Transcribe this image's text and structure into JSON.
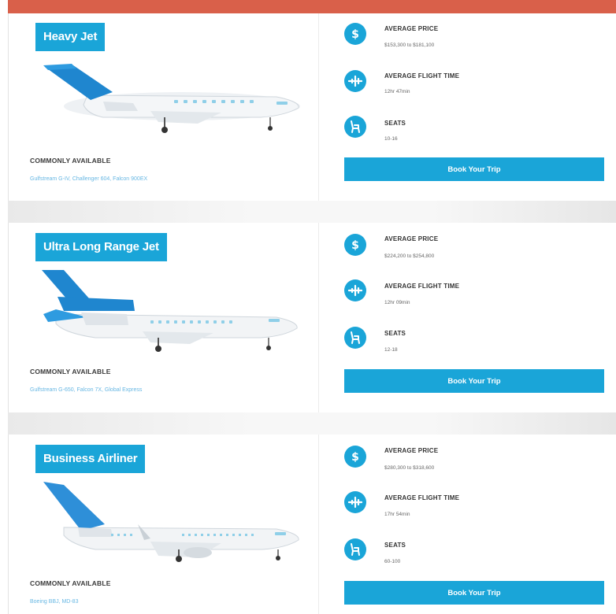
{
  "colors": {
    "accent": "#1aa5d8",
    "top_bar": "#d9604a",
    "link": "#67b7e3"
  },
  "labels": {
    "commonly_available": "COMMONLY AVAILABLE",
    "average_price": "AVERAGE PRICE",
    "average_flight_time": "AVERAGE FLIGHT TIME",
    "seats": "SEATS"
  },
  "cards": [
    {
      "title": "Heavy Jet",
      "models": "Gulfstream G-IV, Challenger 604, Falcon 900EX",
      "price": "$153,300 to $181,100",
      "flight_time": "12hr 47min",
      "seats": "10-16",
      "button": "Book Your Trip"
    },
    {
      "title": "Ultra Long Range Jet",
      "models": "Gulfstream G-650, Falcon 7X, Global Express",
      "price": "$224,200 to $254,800",
      "flight_time": "12hr 09min",
      "seats": "12-18",
      "button": "Book Your Trip"
    },
    {
      "title": "Business Airliner",
      "models": "Boeing BBJ, MD-83",
      "price": "$280,300 to $318,600",
      "flight_time": "17hr 54min",
      "seats": "60-100",
      "button": "Book Your Trip"
    }
  ],
  "icons": {
    "price": "dollar-icon",
    "flight_time": "airplane-icon",
    "seats": "seat-icon"
  }
}
